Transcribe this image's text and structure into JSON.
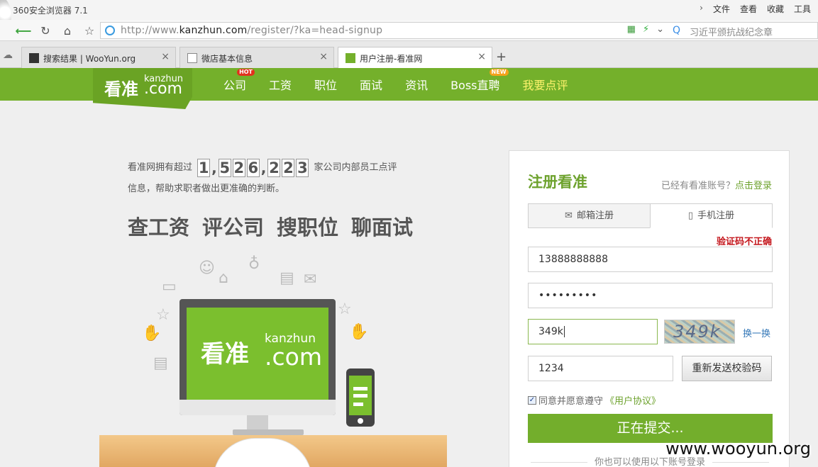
{
  "browser": {
    "window_title": "360安全浏览器 7.1",
    "menu": [
      "文件",
      "查看",
      "收藏",
      "工具"
    ],
    "url_prefix": "http://www.",
    "url_host": "kanzhun.com",
    "url_path": "/register/?ka=head-signup",
    "search_placeholder": "习近平颁抗战纪念章",
    "tabs": [
      {
        "label": "搜索结果 | WooYun.org",
        "active": false
      },
      {
        "label": "微店基本信息",
        "active": false
      },
      {
        "label": "用户注册-看准网",
        "active": true
      }
    ]
  },
  "site": {
    "logo_cn": "看准",
    "logo_en1": "kanzhun",
    "logo_en2": ".com",
    "nav": [
      {
        "label": "公司",
        "badge": "HOT"
      },
      {
        "label": "工资"
      },
      {
        "label": "职位"
      },
      {
        "label": "面试"
      },
      {
        "label": "资讯"
      },
      {
        "label": "Boss直聘",
        "badge": "NEW"
      },
      {
        "label": "我要点评"
      }
    ],
    "accent_color": "#74b02b"
  },
  "intro": {
    "prefix": "看准网拥有超过",
    "digits": [
      "1",
      "5",
      "2",
      "6",
      "2",
      "2",
      "3"
    ],
    "suffix": "家公司内部员工点评",
    "line2": "信息，帮助求职者做出更准确的判断。",
    "slogans": [
      "查工资",
      "评公司",
      "搜职位",
      "聊面试"
    ]
  },
  "register": {
    "title": "注册看准",
    "login_hint": "已经有看准账号？",
    "login_link": "点击登录",
    "tab_email": "邮箱注册",
    "tab_phone": "手机注册",
    "error": "验证码不正确",
    "phone_value": "13888888888",
    "password_value": "•••••••••",
    "captcha_value": "349k",
    "captcha_image_text": "349k",
    "refresh_label": "换一换",
    "sms_code_value": "1234",
    "resend_label": "重新发送校验码",
    "agree_text": "同意并愿意遵守",
    "agree_link": "《用户协议》",
    "submit_label": "正在提交...",
    "other_login": "你也可以使用以下账号登录"
  },
  "watermark": "www.wooyun.org"
}
